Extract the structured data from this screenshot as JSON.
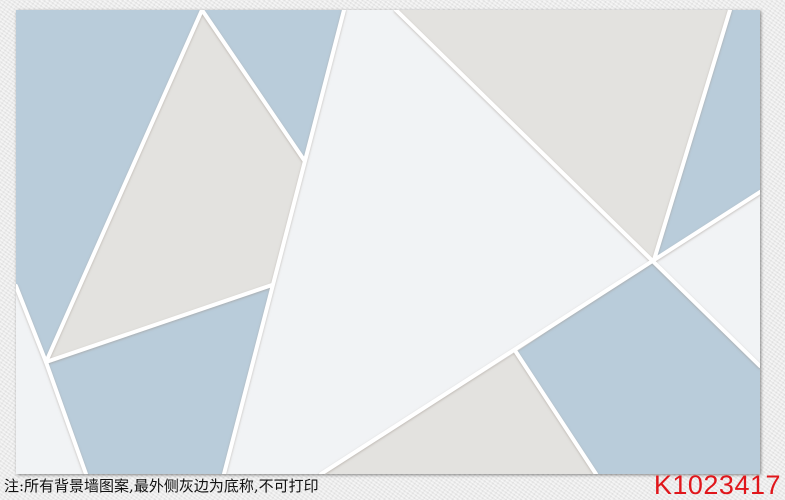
{
  "note": {
    "text": "注:所有背景墙图案,最外侧灰边为底称,不可打印"
  },
  "product_code": "K1023417",
  "colors": {
    "blue": "#b9ccda",
    "gray": "#e3e2df",
    "white": "#f1f3f5",
    "line": "#ffffff",
    "code_red": "#e0161b"
  }
}
